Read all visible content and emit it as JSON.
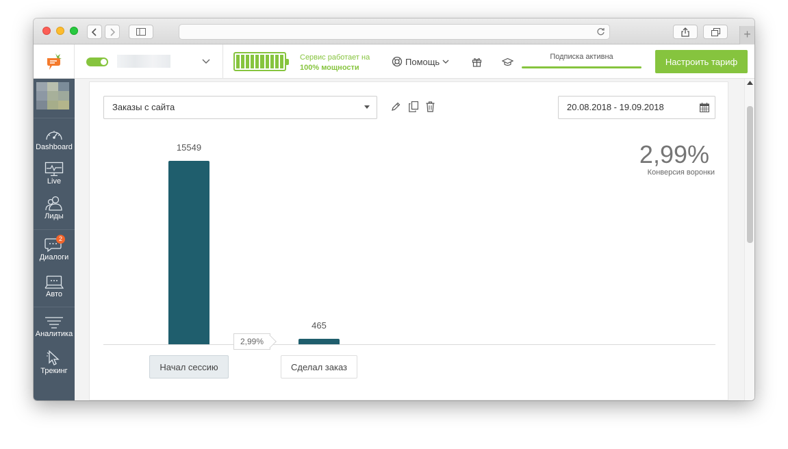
{
  "header": {
    "service_line1": "Сервис работает на",
    "service_line2": "100% мощности",
    "help_label": "Помощь",
    "subscription_label": "Подписка активна",
    "tariff_button": "Настроить тариф"
  },
  "sidebar": {
    "items": [
      {
        "label": "Dashboard",
        "icon": "speedometer-icon"
      },
      {
        "label": "Live",
        "icon": "monitor-pulse-icon"
      },
      {
        "label": "Лиды",
        "icon": "users-icon"
      },
      {
        "label": "Диалоги",
        "icon": "chat-icon",
        "badge": "2"
      },
      {
        "label": "Авто",
        "icon": "auto-message-icon"
      },
      {
        "label": "Аналитика",
        "icon": "funnel-icon"
      },
      {
        "label": "Трекинг",
        "icon": "cursor-icon"
      }
    ]
  },
  "filters": {
    "funnel_select": "Заказы с сайта",
    "date_range": "20.08.2018 - 19.09.2018"
  },
  "summary": {
    "conversion_value": "2,99%",
    "conversion_label": "Конверсия воронки"
  },
  "chart_data": {
    "type": "bar",
    "categories": [
      "Начал сессию",
      "Сделал заказ"
    ],
    "values": [
      15549,
      465
    ],
    "value_labels": [
      "15549",
      "465"
    ],
    "step_conversions": [
      "2,99%"
    ],
    "ylim": [
      0,
      15549
    ]
  },
  "colors": {
    "accent_green": "#86c43e",
    "bar": "#1f5e6d",
    "sidebar": "#4b5a69",
    "badge": "#f3652b"
  }
}
